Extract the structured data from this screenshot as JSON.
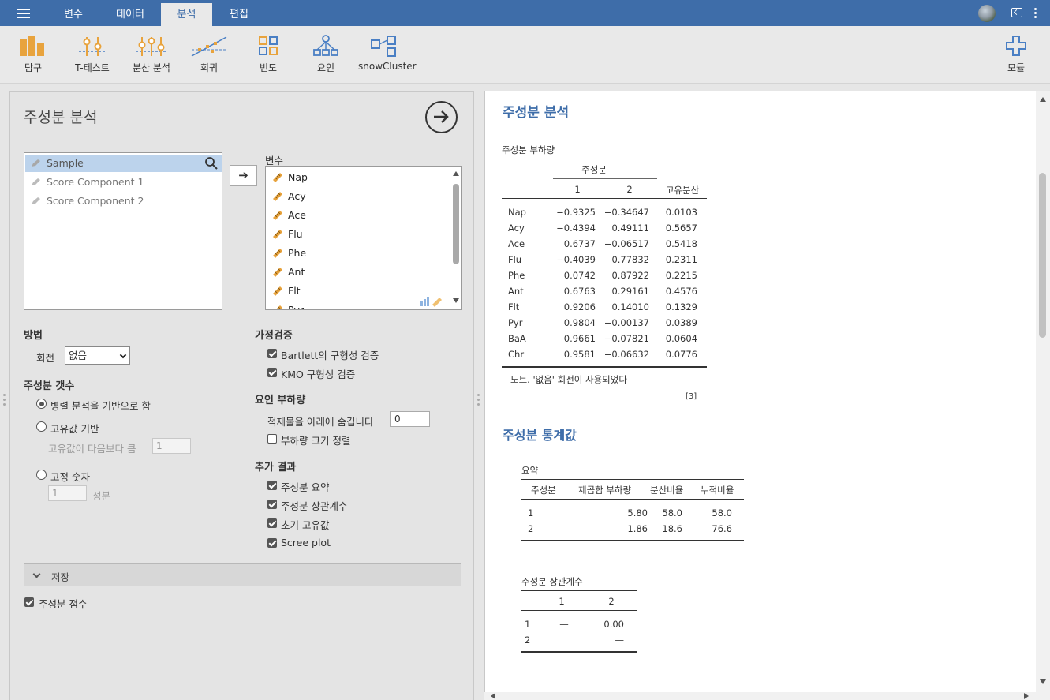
{
  "menu": {
    "tabs": [
      {
        "label": "변수",
        "active": false
      },
      {
        "label": "데이터",
        "active": false
      },
      {
        "label": "분석",
        "active": true
      },
      {
        "label": "편집",
        "active": false
      }
    ]
  },
  "ribbon": {
    "buttons": [
      {
        "label": "탐구",
        "icon": "bar-chart-icon"
      },
      {
        "label": "T-테스트",
        "icon": "ttest-icon"
      },
      {
        "label": "분산 분석",
        "icon": "anova-icon"
      },
      {
        "label": "회귀",
        "icon": "regression-icon"
      },
      {
        "label": "빈도",
        "icon": "frequencies-icon"
      },
      {
        "label": "요인",
        "icon": "factor-icon"
      },
      {
        "label": "snowCluster",
        "icon": "cluster-icon"
      },
      {
        "label": "모듈",
        "icon": "plus-icon"
      }
    ]
  },
  "options": {
    "title": "주성분 분석",
    "source_vars": [
      {
        "label": "Sample",
        "selected": true
      },
      {
        "label": "Score Component 1",
        "selected": false
      },
      {
        "label": "Score Component 2",
        "selected": false
      }
    ],
    "vars_label": "변수",
    "move_arrow": "➔",
    "vars": [
      "Nap",
      "Acy",
      "Ace",
      "Flu",
      "Phe",
      "Ant",
      "Flt",
      "Pyr"
    ],
    "method": {
      "heading": "방법",
      "rotation_label": "회전",
      "rotation_value": "없음"
    },
    "num_components": {
      "heading": "주성분 갯수",
      "parallel": "병렬 분석을 기반으로 함",
      "eigen": "고유값 기반",
      "eigen_above": "고유값이 다음보다 큼",
      "eigen_value": "1",
      "fixed": "고정 숫자",
      "fixed_value": "1",
      "fixed_unit": "성분"
    },
    "assumptions": {
      "heading": "가정검증",
      "bartlett": "Bartlett의 구형성 검증",
      "kmo": "KMO 구형성 검증"
    },
    "loadings": {
      "heading": "요인 부하량",
      "hide_below": "적재물을 아래에 숨깁니다",
      "hide_value": "0",
      "sort": "부하량 크기 정렬"
    },
    "additional": {
      "heading": "추가 결과",
      "summary": "주성분 요약",
      "correlations": "주성분 상관계수",
      "eigenvalues": "초기 고유값",
      "scree": "Scree plot"
    },
    "save": {
      "label": "저장",
      "scores": "주성분 점수"
    }
  },
  "results": {
    "title": "주성분 분석",
    "loadings_table": {
      "title": "주성분 부하량",
      "group_header": "주성분",
      "col1": "1",
      "col2": "2",
      "col3": "고유분산",
      "rows": [
        {
          "name": "Nap",
          "c1": "−0.9325",
          "c2": "−0.34647",
          "u": "0.0103"
        },
        {
          "name": "Acy",
          "c1": "−0.4394",
          "c2": "0.49111",
          "u": "0.5657"
        },
        {
          "name": "Ace",
          "c1": "0.6737",
          "c2": "−0.06517",
          "u": "0.5418"
        },
        {
          "name": "Flu",
          "c1": "−0.4039",
          "c2": "0.77832",
          "u": "0.2311"
        },
        {
          "name": "Phe",
          "c1": "0.0742",
          "c2": "0.87922",
          "u": "0.2215"
        },
        {
          "name": "Ant",
          "c1": "0.6763",
          "c2": "0.29161",
          "u": "0.4576"
        },
        {
          "name": "Flt",
          "c1": "0.9206",
          "c2": "0.14010",
          "u": "0.1329"
        },
        {
          "name": "Pyr",
          "c1": "0.9804",
          "c2": "−0.00137",
          "u": "0.0389"
        },
        {
          "name": "BaA",
          "c1": "0.9661",
          "c2": "−0.07821",
          "u": "0.0604"
        },
        {
          "name": "Chr",
          "c1": "0.9581",
          "c2": "−0.06632",
          "u": "0.0776"
        }
      ],
      "note": "노트. '없음' 회전이 사용되었다",
      "ref": "[3]"
    },
    "stats_title": "주성분 통계값",
    "summary_table": {
      "title": "요약",
      "headers": [
        "주성분",
        "제곱합 부하량",
        "분산비율",
        "누적비율"
      ],
      "rows": [
        [
          "1",
          "5.80",
          "58.0",
          "58.0"
        ],
        [
          "2",
          "1.86",
          "18.6",
          "76.6"
        ]
      ]
    },
    "corr_table": {
      "title": "주성분 상관계수",
      "headers": [
        "1",
        "2"
      ],
      "rows": [
        [
          "1",
          "—",
          "0.00"
        ],
        [
          "2",
          "",
          "—"
        ]
      ]
    }
  },
  "colors": {
    "accent": "#3e6da9",
    "icon_orange": "#e8a33d",
    "icon_blue": "#4a7fc4"
  }
}
